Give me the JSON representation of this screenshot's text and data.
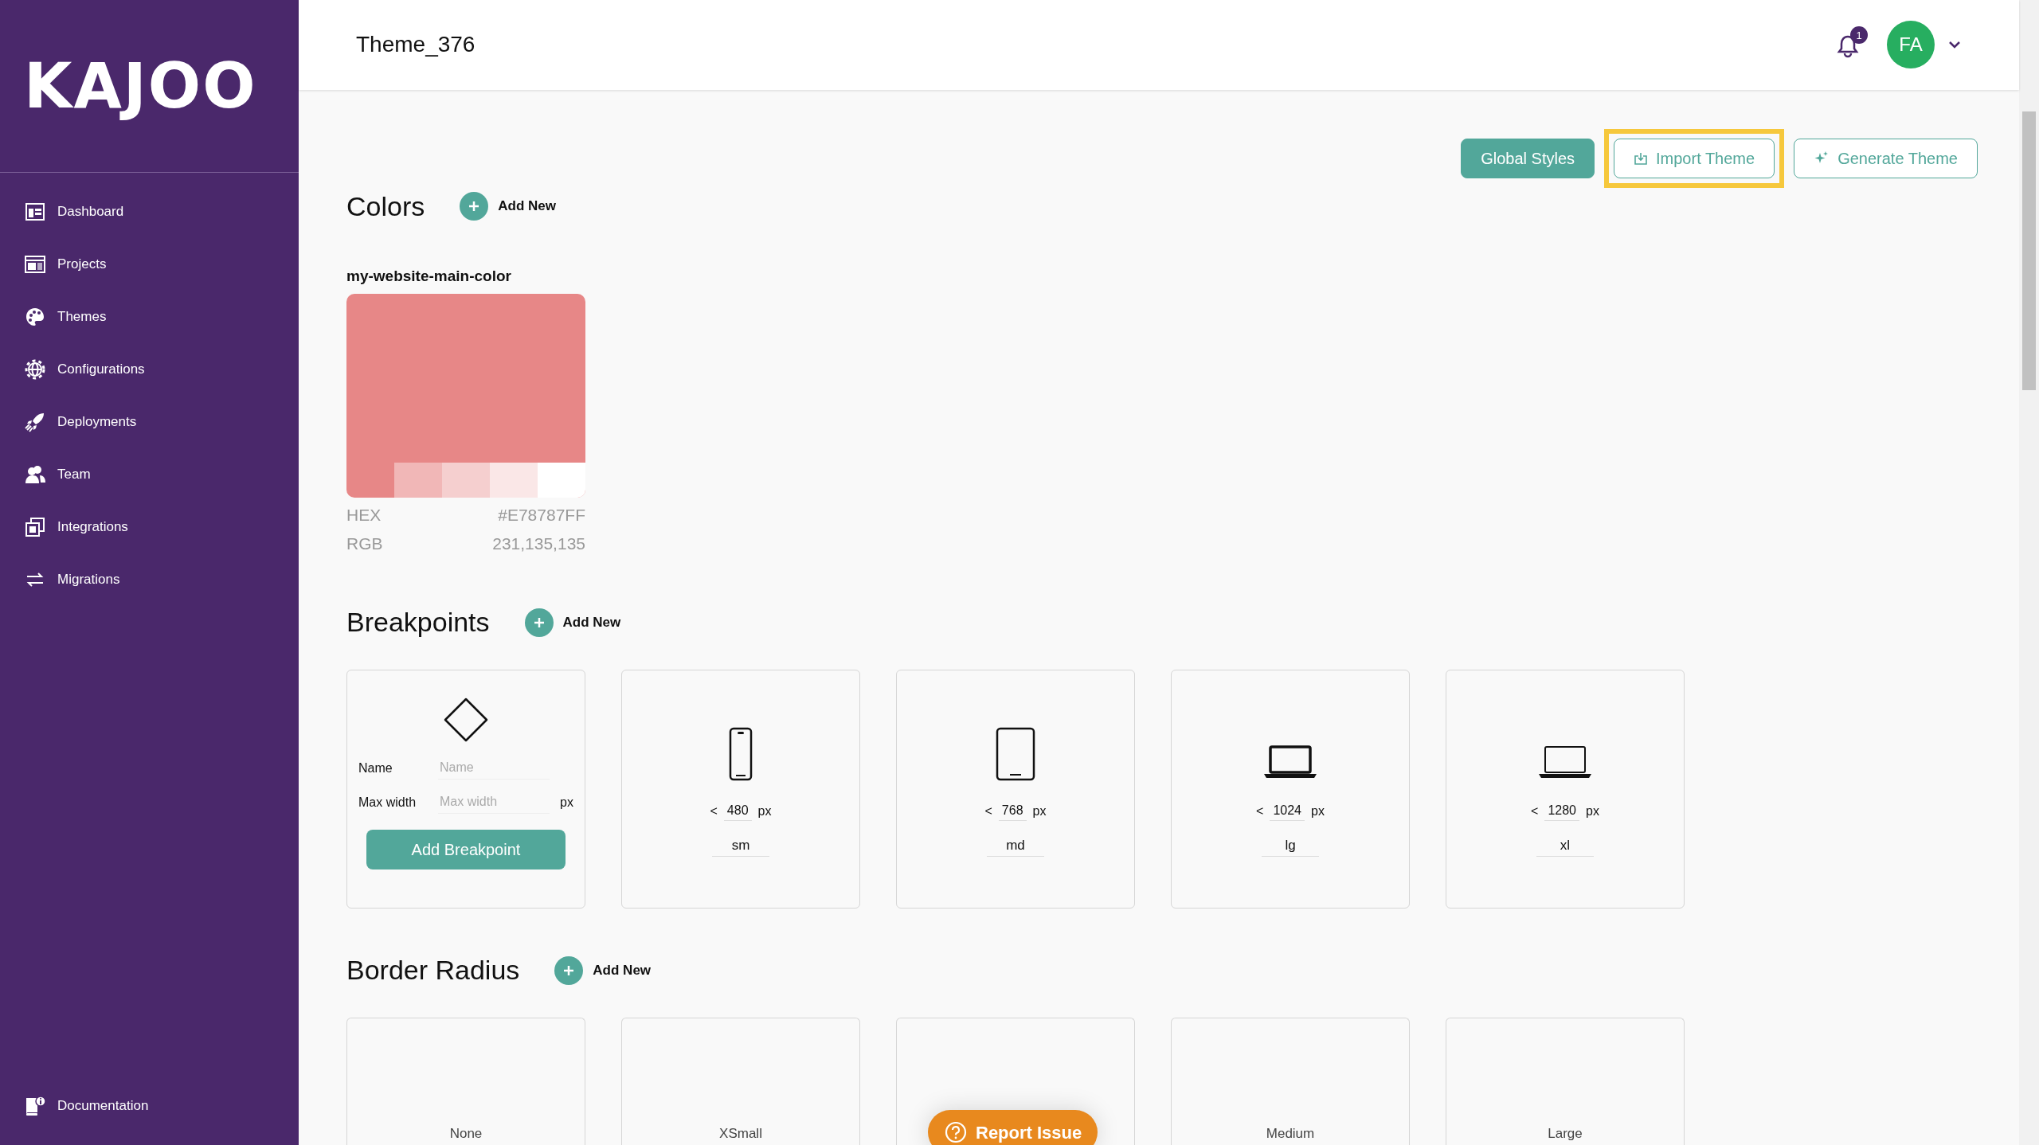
{
  "sidebar": {
    "logo": "KAJOO",
    "items": [
      {
        "label": "Dashboard",
        "kind": "dashboard"
      },
      {
        "label": "Projects",
        "kind": "projects"
      },
      {
        "label": "Themes",
        "kind": "themes"
      },
      {
        "label": "Configurations",
        "kind": "configurations"
      },
      {
        "label": "Deployments",
        "kind": "deployments"
      },
      {
        "label": "Team",
        "kind": "team"
      },
      {
        "label": "Integrations",
        "kind": "integrations"
      },
      {
        "label": "Migrations",
        "kind": "migrations"
      }
    ],
    "footer_item": {
      "label": "Documentation",
      "kind": "documentation"
    }
  },
  "header": {
    "title": "Theme_376",
    "notification_count": "1",
    "avatar": "FA"
  },
  "toolbar": [
    {
      "label": "Global Styles",
      "kind": "solid",
      "highlighted": false
    },
    {
      "label": "Import Theme",
      "kind": "import",
      "highlighted": true
    },
    {
      "label": "Generate Theme",
      "kind": "generate",
      "highlighted": false
    }
  ],
  "colors": {
    "title": "Colors",
    "add_label": "Add New",
    "items": [
      {
        "name": "my-website-main-color",
        "color": "#e78787",
        "hex_label": "HEX",
        "hex": "#E78787FF",
        "rgb_label": "RGB",
        "rgb": "231,135,135"
      }
    ]
  },
  "breakpoints": {
    "title": "Breakpoints",
    "add_label": "Add New",
    "form": {
      "name_label": "Name",
      "name_placeholder": "Name",
      "width_label": "Max width",
      "width_placeholder": "Max width",
      "unit": "px",
      "button": "Add Breakpoint"
    },
    "items": [
      {
        "kind": "phone",
        "prefix": "<",
        "value": "480",
        "unit": "px",
        "name": "sm"
      },
      {
        "kind": "tablet",
        "prefix": "<",
        "value": "768",
        "unit": "px",
        "name": "md"
      },
      {
        "kind": "laptop",
        "prefix": "<",
        "value": "1024",
        "unit": "px",
        "name": "lg"
      },
      {
        "kind": "desktop",
        "prefix": "<",
        "value": "1280",
        "unit": "px",
        "name": "xl"
      }
    ]
  },
  "border_radius": {
    "title": "Border Radius",
    "add_label": "Add New",
    "items": [
      {
        "kind": "labeled",
        "label": "None"
      },
      {
        "kind": "labeled",
        "label": "XSmall"
      },
      {
        "kind": "covered"
      },
      {
        "kind": "labeled",
        "label": "Medium"
      },
      {
        "kind": "labeled",
        "label": "Large"
      }
    ]
  },
  "report_button": "Report Issue"
}
